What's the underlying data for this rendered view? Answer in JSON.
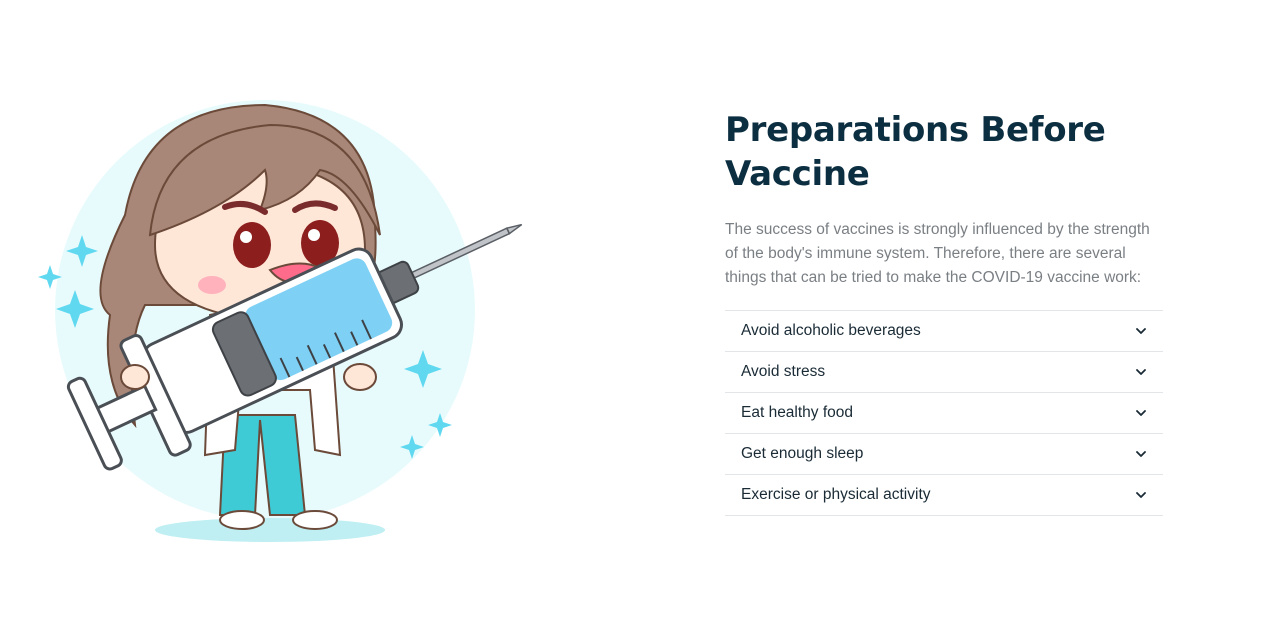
{
  "section": {
    "title_line1": "Preparations Before",
    "title_line2": "Vaccine",
    "description": "The success of vaccines is strongly influenced by the strength of the body's immune system. Therefore, there are several things that can be tried to make the COVID-19 vaccine work:"
  },
  "faq": [
    {
      "label": "Avoid alcoholic beverages",
      "icon": "chevron-down-icon"
    },
    {
      "label": "Avoid stress",
      "icon": "chevron-down-icon"
    },
    {
      "label": "Eat healthy food",
      "icon": "chevron-down-icon"
    },
    {
      "label": "Get enough sleep",
      "icon": "chevron-down-icon"
    },
    {
      "label": "Exercise or physical activity",
      "icon": "chevron-down-icon"
    }
  ],
  "colors": {
    "title": "#0b2e40",
    "text_muted": "#7a7f84",
    "divider": "#e3e6e8",
    "accent_cyan": "#40c8e0",
    "circle_bg": "#e8fbfc"
  }
}
